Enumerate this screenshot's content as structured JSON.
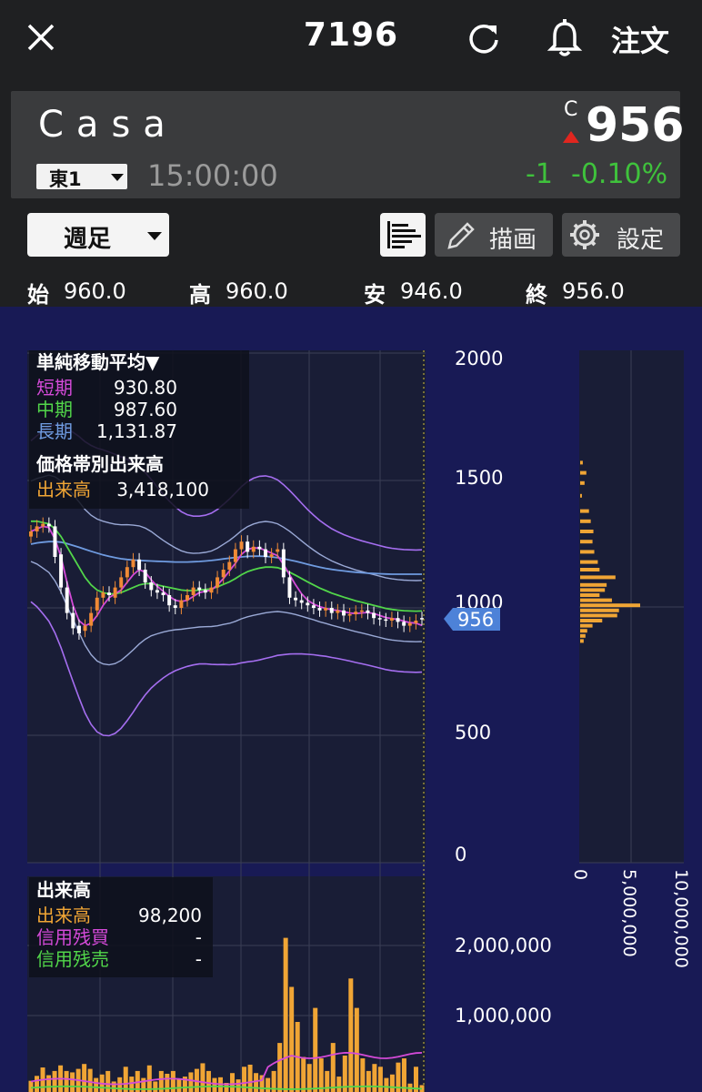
{
  "header": {
    "stock_code": "7196",
    "order_label": "注文",
    "close_icon": "close-icon",
    "refresh_icon": "refresh-icon",
    "bell_icon": "bell-icon"
  },
  "quote": {
    "name": "Casa",
    "market": "東1",
    "time": "15:00:00",
    "flag": "C",
    "price": "956",
    "change": "-1",
    "change_pct": "-0.10%",
    "colors": {
      "up_marker": "#e0261f",
      "change": "#3fc23c"
    }
  },
  "controls": {
    "period": "週足",
    "draw_label": "描画",
    "settings_label": "設定",
    "list_icon": "bars-icon",
    "pencil_icon": "pencil-icon",
    "gear_icon": "gear-icon"
  },
  "ohlc": [
    {
      "label": "始",
      "value": "960.0"
    },
    {
      "label": "高",
      "value": "960.0"
    },
    {
      "label": "安",
      "value": "946.0"
    },
    {
      "label": "終",
      "value": "956.0"
    }
  ],
  "chart_data": {
    "type": "candlestick",
    "y_axis": {
      "ticks": [
        "2000",
        "1500",
        "1000",
        "500",
        "0"
      ],
      "ylim": [
        0,
        2000
      ]
    },
    "current_price_label": "956",
    "sma_panel": {
      "title": "単純移動平均▼",
      "rows": [
        {
          "label": "短期",
          "value": "930.80",
          "color": "#d44ad8"
        },
        {
          "label": "中期",
          "value": "987.60",
          "color": "#52d64a"
        },
        {
          "label": "長期",
          "value": "1,131.87",
          "color": "#6f9be0"
        }
      ]
    },
    "vp_panel": {
      "title": "価格帯別出来高",
      "label": "出来高",
      "value": "3,418,100"
    },
    "volume_profile_axis": [
      "0",
      "5,000,000",
      "10,000,000"
    ],
    "volume_panel": {
      "title": "出来高",
      "rows": [
        {
          "label": "出来高",
          "value": "98,200",
          "color": "#f0a535"
        },
        {
          "label": "信用残買",
          "value": "-",
          "color": "#d44ad8"
        },
        {
          "label": "信用残売",
          "value": "-",
          "color": "#52d64a"
        }
      ],
      "y_ticks": [
        "2,000,000",
        "1,000,000"
      ]
    },
    "closes": [
      1300,
      1320,
      1330,
      1320,
      1200,
      1080,
      980,
      920,
      900,
      930,
      980,
      1040,
      1060,
      1050,
      1080,
      1120,
      1160,
      1190,
      1150,
      1100,
      1070,
      1060,
      1050,
      1010,
      1000,
      1030,
      1050,
      1080,
      1070,
      1060,
      1080,
      1120,
      1150,
      1180,
      1230,
      1260,
      1220,
      1240,
      1230,
      1200,
      1210,
      1230,
      1120,
      1040,
      1030,
      1020,
      1010,
      1000,
      990,
      1000,
      980,
      990,
      970,
      975,
      985,
      990,
      980,
      960,
      955,
      950,
      960,
      945,
      930,
      940,
      950,
      956
    ],
    "opens": [
      1280,
      1300,
      1320,
      1330,
      1320,
      1210,
      1080,
      980,
      930,
      910,
      930,
      990,
      1040,
      1060,
      1040,
      1080,
      1120,
      1160,
      1190,
      1150,
      1100,
      1070,
      1060,
      1050,
      1010,
      1000,
      1030,
      1050,
      1080,
      1070,
      1060,
      1080,
      1120,
      1150,
      1180,
      1230,
      1260,
      1220,
      1240,
      1230,
      1200,
      1220,
      1230,
      1120,
      1040,
      1030,
      1020,
      1010,
      1000,
      990,
      1000,
      980,
      990,
      970,
      975,
      985,
      990,
      980,
      960,
      955,
      950,
      960,
      945,
      930,
      940,
      960
    ],
    "sma_short": [
      1300,
      1310,
      1320,
      1315,
      1270,
      1200,
      1100,
      1010,
      950,
      930,
      940,
      970,
      1010,
      1040,
      1055,
      1070,
      1100,
      1130,
      1150,
      1140,
      1110,
      1085,
      1065,
      1045,
      1030,
      1025,
      1030,
      1045,
      1060,
      1065,
      1070,
      1090,
      1115,
      1145,
      1175,
      1210,
      1230,
      1235,
      1235,
      1225,
      1215,
      1205,
      1170,
      1130,
      1090,
      1055,
      1030,
      1015,
      1005,
      998,
      993,
      990,
      985,
      980,
      978,
      980,
      982,
      978,
      970,
      962,
      958,
      955,
      948,
      942,
      940,
      931
    ],
    "sma_mid": [
      1340,
      1340,
      1335,
      1330,
      1310,
      1280,
      1240,
      1200,
      1160,
      1120,
      1090,
      1070,
      1060,
      1055,
      1055,
      1060,
      1070,
      1080,
      1090,
      1095,
      1095,
      1090,
      1085,
      1080,
      1075,
      1070,
      1068,
      1068,
      1070,
      1072,
      1075,
      1082,
      1092,
      1102,
      1115,
      1130,
      1142,
      1150,
      1156,
      1160,
      1160,
      1158,
      1150,
      1140,
      1128,
      1115,
      1102,
      1090,
      1078,
      1068,
      1058,
      1050,
      1042,
      1035,
      1028,
      1022,
      1016,
      1010,
      1004,
      998,
      994,
      991,
      989,
      988,
      987,
      988
    ],
    "sma_long": [
      1250,
      1255,
      1258,
      1260,
      1260,
      1258,
      1252,
      1245,
      1238,
      1230,
      1222,
      1215,
      1208,
      1202,
      1197,
      1193,
      1190,
      1188,
      1186,
      1185,
      1184,
      1183,
      1182,
      1181,
      1180,
      1180,
      1180,
      1181,
      1182,
      1184,
      1186,
      1189,
      1192,
      1195,
      1198,
      1200,
      1202,
      1203,
      1203,
      1202,
      1200,
      1197,
      1193,
      1188,
      1183,
      1177,
      1171,
      1165,
      1160,
      1155,
      1151,
      1148,
      1145,
      1142,
      1140,
      1138,
      1136,
      1135,
      1134,
      1133,
      1132,
      1132,
      1132,
      1132,
      1132,
      1132
    ],
    "volumes": [
      160000,
      230000,
      350000,
      240000,
      300000,
      380000,
      300000,
      280000,
      330000,
      400000,
      330000,
      200000,
      250000,
      300000,
      150000,
      210000,
      360000,
      220000,
      300000,
      200000,
      380000,
      150000,
      300000,
      260000,
      300000,
      190000,
      220000,
      280000,
      330000,
      410000,
      300000,
      200000,
      210000,
      130000,
      270000,
      180000,
      360000,
      390000,
      270000,
      240000,
      200000,
      300000,
      700000,
      2200000,
      1500000,
      1000000,
      500000,
      400000,
      1200000,
      480000,
      300000,
      700000,
      220000,
      520000,
      1620000,
      1200000,
      480000,
      300000,
      400000,
      360000,
      200000,
      250000,
      420000,
      480000,
      120000,
      360000,
      98200
    ]
  }
}
